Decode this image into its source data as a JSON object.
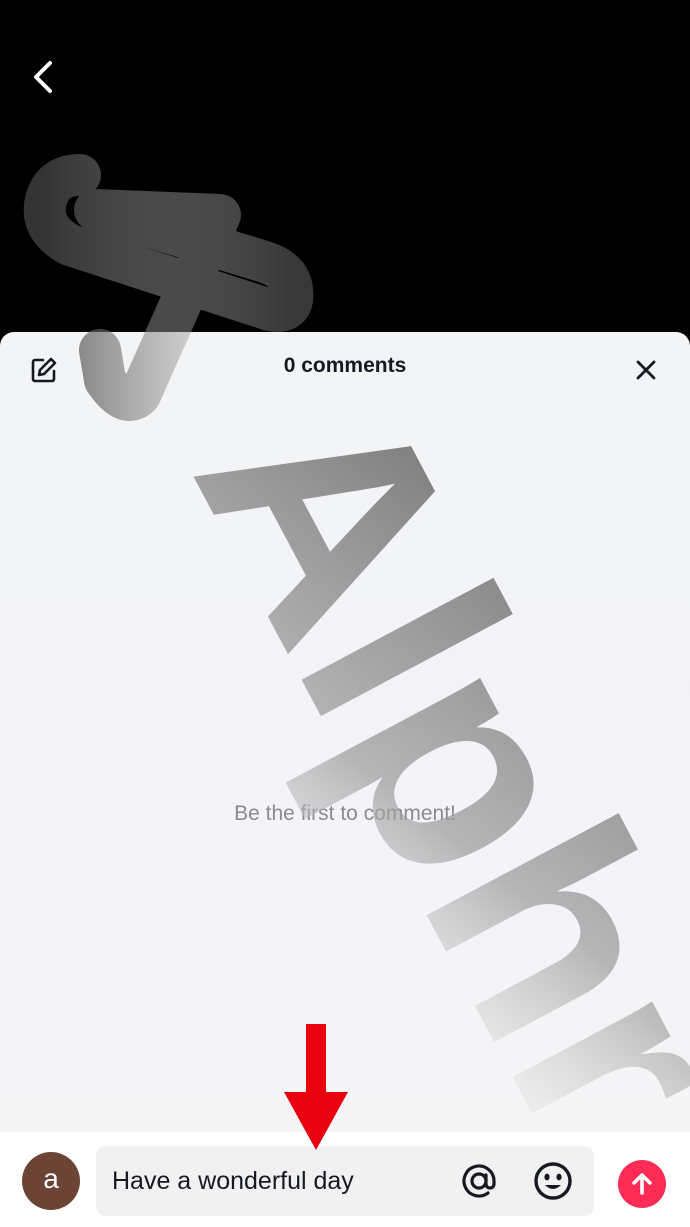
{
  "header": {
    "back_icon": "chevron-left-icon"
  },
  "sheet": {
    "title": "0 comments",
    "edit_icon": "edit-icon",
    "close_icon": "close-icon",
    "empty_message": "Be the first to comment!"
  },
  "composer": {
    "avatar_letter": "a",
    "avatar_color": "#6b4436",
    "input_value": "Have a wonderful day",
    "mention_icon": "at-icon",
    "emoji_icon": "emoji-icon",
    "send_icon": "send-arrow-icon",
    "send_color": "#fe2c55"
  },
  "annotation": {
    "arrow_color": "#e8000f"
  },
  "watermark": {
    "text": "Alphr"
  }
}
